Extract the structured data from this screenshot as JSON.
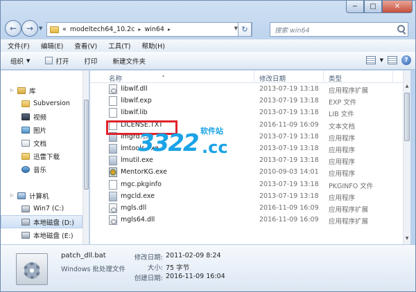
{
  "title_bar": {
    "minimize": "−",
    "maximize": "□",
    "close": "✕"
  },
  "nav": {
    "back": "←",
    "forward": "→",
    "history": "▼"
  },
  "address": {
    "prefix": "«",
    "crumbs": [
      "modeltech64_10.2c",
      "win64"
    ],
    "sep": "▸",
    "refresh": "↻"
  },
  "search": {
    "placeholder": "搜索 win64"
  },
  "menu": [
    "文件(F)",
    "编辑(E)",
    "查看(V)",
    "工具(T)",
    "帮助(H)"
  ],
  "toolbar": {
    "organize": "组织",
    "open": "打开",
    "print": "打印",
    "new_folder": "新建文件夹",
    "caret": "▼",
    "help": "?"
  },
  "sidebar": {
    "library": "库",
    "libs": [
      "Subversion",
      "视频",
      "图片",
      "文档",
      "迅雷下载",
      "音乐"
    ],
    "computer": "计算机",
    "drives": [
      "Win7 (C:)",
      "本地磁盘 (D:)",
      "本地磁盘 (E:)"
    ],
    "expand": "▷"
  },
  "columns": {
    "name": "名称",
    "date": "修改日期",
    "type": "类型",
    "sort": "▴"
  },
  "files": [
    {
      "name": "libwlf.dll",
      "date": "2013-07-19 13:18",
      "type": "应用程序扩展",
      "kind": "dll"
    },
    {
      "name": "libwlf.exp",
      "date": "2013-07-19 13:18",
      "type": "EXP 文件",
      "kind": "doc"
    },
    {
      "name": "libwlf.lib",
      "date": "2013-07-19 13:18",
      "type": "LIB 文件",
      "kind": "doc"
    },
    {
      "name": "LICENSE.TXT",
      "date": "2016-11-09 16:09",
      "type": "文本文档",
      "kind": "doc"
    },
    {
      "name": "lmgrd.exe",
      "date": "2013-07-19 13:18",
      "type": "应用程序",
      "kind": "exe"
    },
    {
      "name": "lmtools.exe",
      "date": "2013-07-19 13:18",
      "type": "应用程序",
      "kind": "exe"
    },
    {
      "name": "lmutil.exe",
      "date": "2013-07-19 13:18",
      "type": "应用程序",
      "kind": "exe"
    },
    {
      "name": "MentorKG.exe",
      "date": "2010-09-03 14:01",
      "type": "应用程序",
      "kind": "mentor"
    },
    {
      "name": "mgc.pkginfo",
      "date": "2013-07-19 13:18",
      "type": "PKGINFO 文件",
      "kind": "doc"
    },
    {
      "name": "mgcld.exe",
      "date": "2013-07-19 13:18",
      "type": "应用程序",
      "kind": "exe"
    },
    {
      "name": "mgls.dll",
      "date": "2016-11-09 16:09",
      "type": "应用程序扩展",
      "kind": "dll"
    },
    {
      "name": "mgls64.dll",
      "date": "2016-11-09 16:09",
      "type": "应用程序扩展",
      "kind": "dll"
    }
  ],
  "watermark": {
    "big": "3322",
    "cc": ".cc",
    "small": "软件站"
  },
  "details": {
    "name": "patch_dll.bat",
    "type": "Windows 批处理文件",
    "modified_label": "修改日期:",
    "modified_value": "2011-02-09 8:24",
    "size_label": "大小:",
    "size_value": "75 字节",
    "created_label": "创建日期:",
    "created_value": "2016-11-09 16:04"
  },
  "colors": {
    "highlight": "#e0232d",
    "watermark": "#1aa3e6"
  }
}
